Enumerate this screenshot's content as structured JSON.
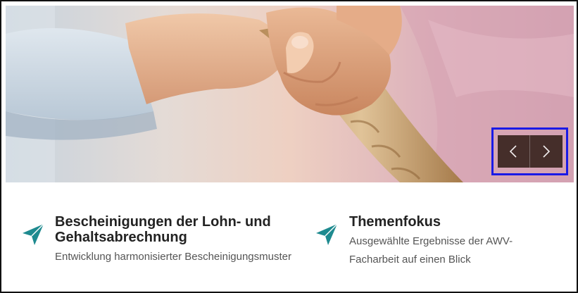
{
  "slider": {
    "prev_icon": "chevron-left-icon",
    "next_icon": "chevron-right-icon",
    "control_bg": "#38241e",
    "highlight_color": "#1a1ae6"
  },
  "teasers": [
    {
      "icon": "paper-plane-icon",
      "title": "Bescheinigungen der Lohn- und Gehaltsabrechnung",
      "description": "Entwicklung harmonisierter Bescheinigungsmuster"
    },
    {
      "icon": "paper-plane-icon",
      "title": "Themenfokus",
      "description": "Ausgewählte Ergebnisse der AWV-Facharbeit auf einen Blick"
    }
  ],
  "colors": {
    "accent": "#1e8a8f",
    "title": "#222222",
    "text": "#555555"
  }
}
